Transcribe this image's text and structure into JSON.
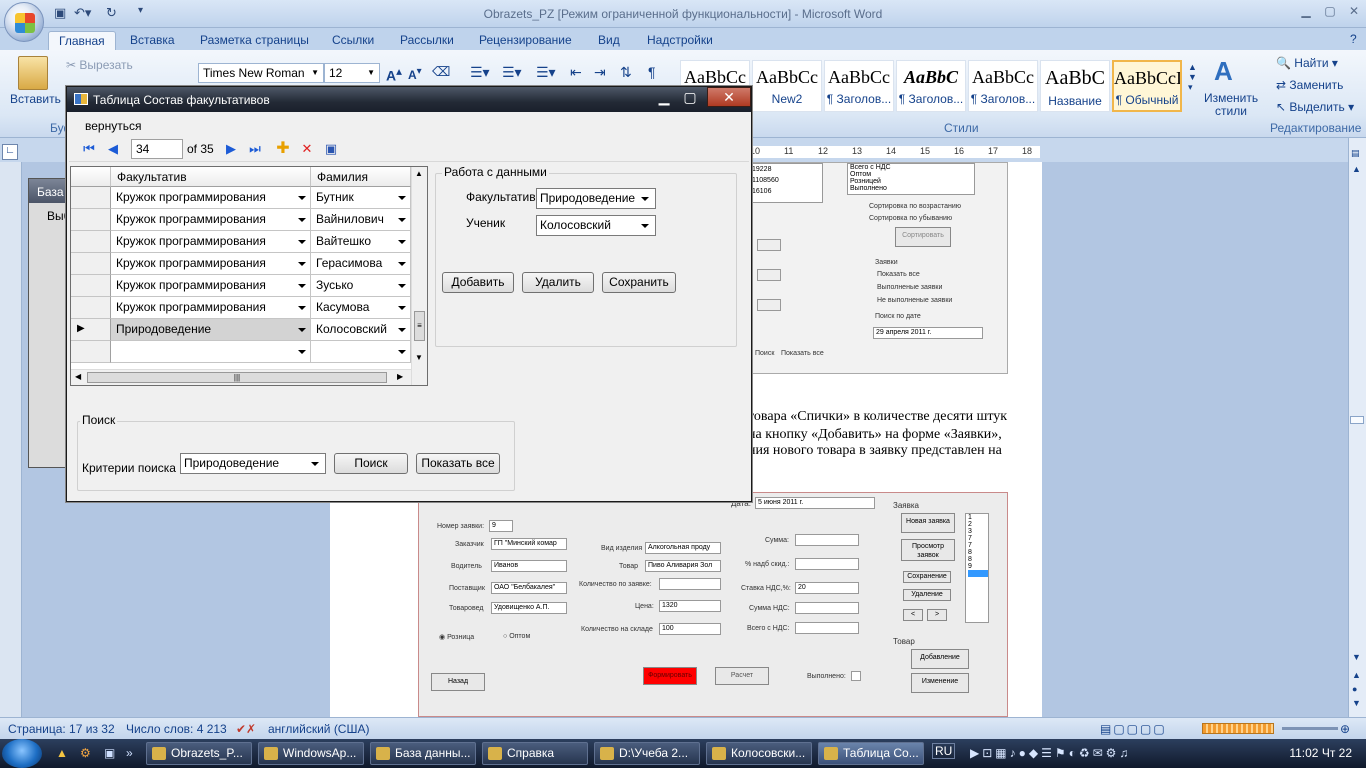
{
  "word": {
    "title": "Obrazets_PZ [Режим ограниченной функциональности] - Microsoft Word",
    "tabs": [
      "Главная",
      "Вставка",
      "Разметка страницы",
      "Ссылки",
      "Рассылки",
      "Рецензирование",
      "Вид",
      "Надстройки"
    ],
    "clipboard": {
      "paste": "Вставить",
      "cut": "Вырезать",
      "group": "Буф"
    },
    "font_name": "Times New Roman",
    "font_size": "12",
    "styles": [
      {
        "sample": "AaBbCc",
        "name": ""
      },
      {
        "sample": "AaBbCc",
        "name": "New2"
      },
      {
        "sample": "AaBbCc",
        "name": "¶ Заголов..."
      },
      {
        "sample": "AaBbC",
        "name": "¶ Заголов..."
      },
      {
        "sample": "AaBbCc",
        "name": "¶ Заголов..."
      },
      {
        "sample": "AaBbC",
        "name": "Название"
      },
      {
        "sample": "AaBbCcI",
        "name": "¶ Обычный"
      }
    ],
    "styles_group": "Стили",
    "change_styles": "Изменить стили",
    "editing": {
      "find": "Найти",
      "replace": "Заменить",
      "select": "Выделить",
      "group": "Редактирование"
    },
    "ruler_marks": [
      "10",
      "11",
      "12",
      "13",
      "14",
      "15",
      "16",
      "17",
      "18"
    ],
    "doc_lines": [
      "товара «Спички» в количестве десяти штук",
      "на кнопку «Добавить» на форме «Заявки»,",
      "ния нового товара в заявку представлен на"
    ],
    "status": {
      "page": "Страница: 17 из 32",
      "words": "Число слов: 4 213",
      "lang": "английский (США)"
    }
  },
  "bg_window": {
    "title": "База д",
    "text": "Выб"
  },
  "embedded_top": {
    "values": [
      "19228",
      "1108560",
      "16106"
    ],
    "list": [
      "Всего с НДС",
      "Оптом",
      "Розницей",
      "Выполнено"
    ],
    "sort_asc": "Сортировка по возрастанию",
    "sort_desc": "Сортировка по убыванию",
    "sort_btn": "Сортировать",
    "orders": "Заявки",
    "show_all": "Показать все",
    "done": "Выполненые заявки",
    "not_done": "Не выполненые заявки",
    "search_date": "Поиск по дате",
    "date": "29  апреля  2011 г.",
    "search": "Поиск",
    "show_all2": "Показать все"
  },
  "embedded_form": {
    "date_label": "Дата:",
    "date": "5  июня  2011 г.",
    "order_group": "Заявка",
    "order_no_label": "Номер заявки:",
    "order_no": "9",
    "customer_label": "Заказчик",
    "customer": "ГП \"Минский комар",
    "driver_label": "Водитель",
    "driver": "Иванов",
    "supplier_label": "Поставщик",
    "supplier": "ОАО \"Белбакалея\"",
    "merch_label": "Товаровед",
    "merch": "Удовищенко А.П.",
    "retail": "Розница",
    "wholesale": "Оптом",
    "kind_label": "Вид изделия",
    "kind": "Алкогольная проду",
    "goods_label": "Товар",
    "goods": "Пиво Аливария Зол",
    "qty_label": "Количество по заявке:",
    "price_label": "Цена:",
    "price": "1320",
    "stock_label": "Количество на складе",
    "stock": "100",
    "sum_label": "Сумма:",
    "markup_label": "% надб  скид.:",
    "vat_label": "Ставка НДС,%:",
    "vat": "20",
    "vat_sum_label": "Сумма НДС:",
    "total_label": "Всего с НДС:",
    "new_order": "Новая заявка",
    "view_orders": "Просмотр заявок",
    "save": "Сохранение",
    "delete": "Удаление",
    "list": [
      "1",
      "2",
      "3",
      "7",
      "7",
      "8",
      "8",
      "9"
    ],
    "goods_group": "Товар",
    "add": "Добавление",
    "edit": "Изменение",
    "back": "Назад",
    "form_btn": "Формировать",
    "calc_btn": "Расчет",
    "done_label": "Выполнено:"
  },
  "dialog": {
    "title": "Таблица Состав факультативов",
    "menu_back": "вернуться",
    "position": "34",
    "count": "of 35",
    "columns": [
      "Факультатив",
      "Фамилия"
    ],
    "rows": [
      {
        "course": "Кружок программирования",
        "name": "Бутник"
      },
      {
        "course": "Кружок программирования",
        "name": "Вайнилович"
      },
      {
        "course": "Кружок программирования",
        "name": "Вайтешко"
      },
      {
        "course": "Кружок программирования",
        "name": "Герасимова"
      },
      {
        "course": "Кружок программирования",
        "name": "Зуськo"
      },
      {
        "course": "Кружок программирования",
        "name": "Касумова"
      },
      {
        "course": "Природоведение",
        "name": "Колосовский"
      },
      {
        "course": "",
        "name": ""
      }
    ],
    "data_group": "Работа с данными",
    "course_label": "Факультатив",
    "course_value": "Природоведение",
    "student_label": "Ученик",
    "student_value": "Колосовский",
    "add": "Добавить",
    "delete": "Удалить",
    "save": "Сохранить",
    "search_group": "Поиск",
    "criteria_label": "Критерии поиска",
    "criteria_value": "Природоведение",
    "search_btn": "Поиск",
    "show_all_btn": "Показать все"
  },
  "taskbar": {
    "items": [
      "Obrazets_P...",
      "WindowsAp...",
      "База данны...",
      "Справка",
      "D:\\Учеба 2...",
      "Колосовски...",
      "Таблица Со..."
    ],
    "lang": "RU",
    "clock": "11:02 Чт 22"
  },
  "colors": {
    "form_button_red": "#ff0000",
    "selection_blue": "#3399ff"
  }
}
